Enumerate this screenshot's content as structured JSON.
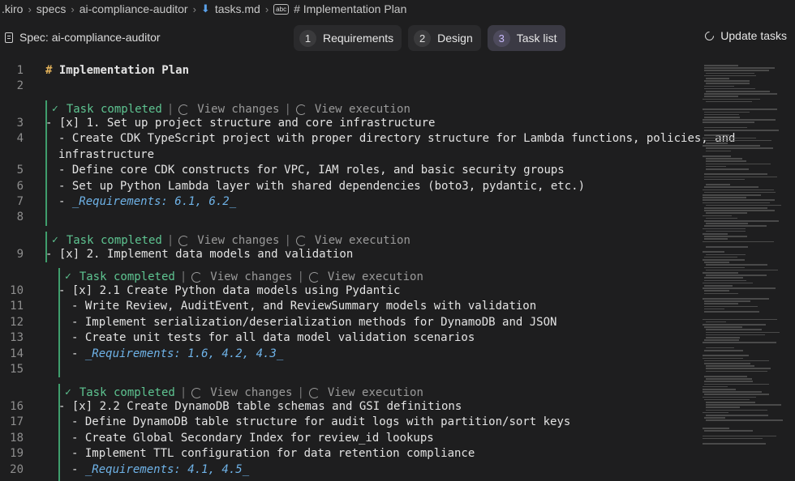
{
  "breadcrumb": [
    ".kiro",
    "specs",
    "ai-compliance-auditor",
    "tasks.md",
    "# Implementation Plan"
  ],
  "toolbar": {
    "spec_title": "Spec: ai-compliance-auditor",
    "tabs": [
      {
        "num": "1",
        "label": "Requirements"
      },
      {
        "num": "2",
        "label": "Design"
      },
      {
        "num": "3",
        "label": "Task list"
      }
    ],
    "active_tab": "Task list",
    "update_label": "Update tasks"
  },
  "codelens": {
    "completed": "Task completed",
    "view_changes": "View changes",
    "view_execution": "View execution",
    "separator": "|"
  },
  "lines": [
    {
      "n": "1",
      "hash": "#",
      "text": " Implementation Plan"
    },
    {
      "n": "2",
      "text": ""
    },
    {
      "n": "3",
      "text": "- [x] 1. Set up project structure and core infrastructure"
    },
    {
      "n": "4",
      "text": "- Create CDK TypeScript project with proper directory structure for Lambda functions, policies, and"
    },
    {
      "n": "",
      "text": "infrastructure"
    },
    {
      "n": "5",
      "text": "- Define core CDK constructs for VPC, IAM roles, and basic security groups"
    },
    {
      "n": "6",
      "text": "- Set up Python Lambda layer with shared dependencies (boto3, pydantic, etc.)"
    },
    {
      "n": "7",
      "prefix": "- ",
      "req": "_Requirements: 6.1, 6.2_"
    },
    {
      "n": "8",
      "text": ""
    },
    {
      "n": "9",
      "text": "- [x] 2. Implement data models and validation"
    },
    {
      "n": "10",
      "text": "- [x] 2.1 Create Python data models using Pydantic"
    },
    {
      "n": "11",
      "text": "- Write Review, AuditEvent, and ReviewSummary models with validation"
    },
    {
      "n": "12",
      "text": "- Implement serialization/deserialization methods for DynamoDB and JSON"
    },
    {
      "n": "13",
      "text": "- Create unit tests for all data model validation scenarios"
    },
    {
      "n": "14",
      "prefix": "- ",
      "req": "_Requirements: 1.6, 4.2, 4.3_"
    },
    {
      "n": "15",
      "text": ""
    },
    {
      "n": "16",
      "text": "- [x] 2.2 Create DynamoDB table schemas and GSI definitions"
    },
    {
      "n": "17",
      "text": "- Define DynamoDB table structure for audit logs with partition/sort keys"
    },
    {
      "n": "18",
      "text": "- Create Global Secondary Index for review_id lookups"
    },
    {
      "n": "19",
      "text": "- Implement TTL configuration for data retention compliance"
    },
    {
      "n": "20",
      "prefix": "- ",
      "req": "_Requirements: 4.1, 4.5_"
    }
  ],
  "colors": {
    "background": "#1e1e1f",
    "completed_green": "#5ec491",
    "requirements_blue": "#6fb3e8",
    "heading_hash": "#e3b25a"
  }
}
